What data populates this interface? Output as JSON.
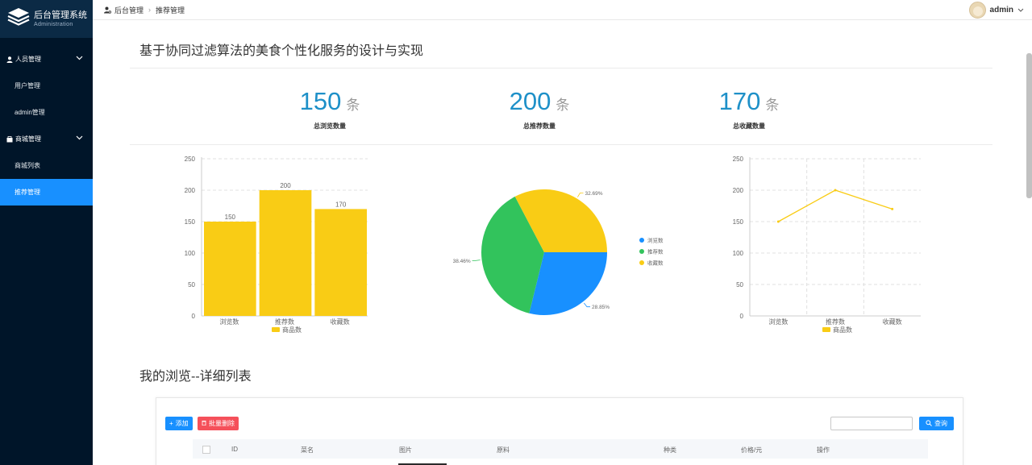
{
  "app": {
    "logo_title": "后台管理系统",
    "logo_sub": "Administration"
  },
  "sidebar": {
    "groups": [
      {
        "label": "人员管理",
        "items": [
          "用户管理",
          "admin管理"
        ]
      },
      {
        "label": "商城管理",
        "items": [
          "商城列表",
          "推荐管理"
        ]
      }
    ],
    "active_item": "推荐管理"
  },
  "header": {
    "breadcrumb": [
      "后台管理",
      "推荐管理"
    ],
    "username": "admin"
  },
  "page": {
    "title": "基于协同过滤算法的美食个性化服务的设计与实现",
    "section_title": "我的浏览--详细列表"
  },
  "stats": [
    {
      "value": "150",
      "unit": "条",
      "label": "总浏览数量"
    },
    {
      "value": "200",
      "unit": "条",
      "label": "总推荐数量"
    },
    {
      "value": "170",
      "unit": "条",
      "label": "总收藏数量"
    }
  ],
  "chart_data": [
    {
      "type": "bar",
      "categories": [
        "浏览数",
        "推荐数",
        "收藏数"
      ],
      "series": [
        {
          "name": "商品数",
          "values": [
            150,
            200,
            170
          ]
        }
      ],
      "ylim": [
        0,
        250
      ],
      "yticks": [
        "0",
        "50",
        "100",
        "150",
        "200",
        "250"
      ],
      "color": "#f9cc15",
      "legend": "bottom"
    },
    {
      "type": "pie",
      "slices": [
        {
          "name": "浏览数",
          "value": 150,
          "label": "28.85%",
          "color": "#1890ff"
        },
        {
          "name": "推荐数",
          "value": 200,
          "label": "38.46%",
          "color": "#32c35c"
        },
        {
          "name": "收藏数",
          "value": 170,
          "label": "32.69%",
          "color": "#f9cc15"
        }
      ],
      "legend": "right"
    },
    {
      "type": "line",
      "categories": [
        "浏览数",
        "推荐数",
        "收藏数"
      ],
      "series": [
        {
          "name": "商品数",
          "values": [
            150,
            200,
            170
          ]
        }
      ],
      "ylim": [
        0,
        250
      ],
      "yticks": [
        "0",
        "50",
        "100",
        "150",
        "200",
        "250"
      ],
      "color": "#f9cc15",
      "grid": true,
      "legend": "bottom"
    }
  ],
  "toolbar": {
    "add_label": "添加",
    "batch_delete_label": "批量删除",
    "search_placeholder": "",
    "search_label": "查询"
  },
  "table": {
    "columns": [
      "ID",
      "菜名",
      "图片",
      "原料",
      "种类",
      "价格/元",
      "操作"
    ]
  },
  "colors": {
    "sidebar_bg": "#001529",
    "active": "#1890ff",
    "danger": "#f5505a",
    "stat_number": "#1e90c8"
  }
}
